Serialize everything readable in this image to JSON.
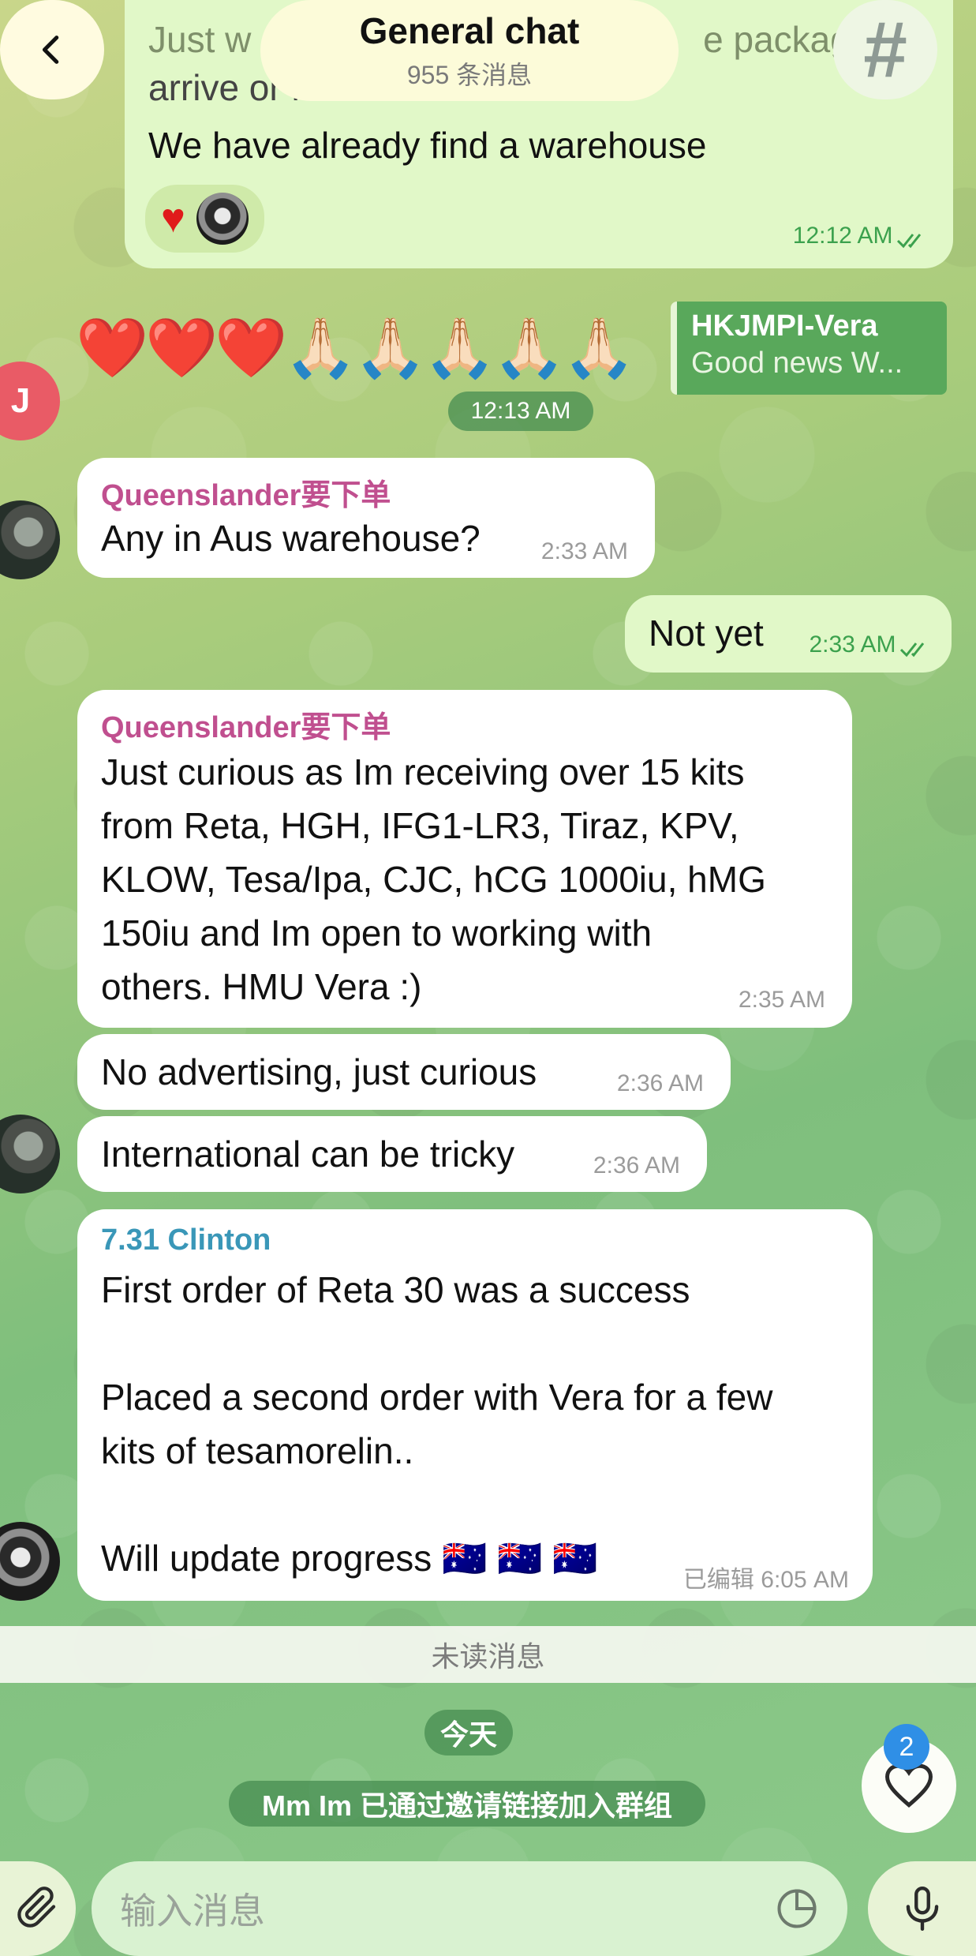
{
  "header": {
    "title": "General chat",
    "subtitle": "955 条消息"
  },
  "messages": {
    "top_partial_line1": "Just w",
    "top_partial_line1b": "e packag",
    "top_partial_line2": "arrive or not",
    "top_main": "We have already find a warehouse",
    "top_time": "12:12 AM",
    "reply_name": "HKJMPI-Vera",
    "reply_text": "Good news W...",
    "emoji_text": "❤️❤️❤️🙏🏻🙏🏻🙏🏻🙏🏻🙏🏻",
    "emoji_time": "12:13 AM",
    "j_avatar_letter": "J",
    "q1_sender": "Queenslander要下单",
    "q1_text": "Any in Aus warehouse?",
    "q1_time": "2:33 AM",
    "notyet_text": "Not yet",
    "notyet_time": "2:33 AM",
    "q2_sender": "Queenslander要下单",
    "q2_text": "Just curious as Im receiving over 15 kits\nfrom Reta, HGH, IFG1-LR3, Tiraz, KPV,\nKLOW, Tesa/Ipa, CJC, hCG 1000iu, hMG\n150iu and Im open to working with\nothers. HMU Vera :)",
    "q2_time": "2:35 AM",
    "q3_text": "No advertising, just curious",
    "q3_time": "2:36 AM",
    "q4_text": "International can be tricky",
    "q4_time": "2:36 AM",
    "c_sender": "7.31 Clinton",
    "c_text": "First order of Reta 30 was a success\n\nPlaced a second order with Vera for a few\nkits of tesamorelin..\n\nWill update progress 🇦🇺 🇦🇺 🇦🇺",
    "c_edited": "已编辑",
    "c_time": "6:05 AM"
  },
  "unread_label": "未读消息",
  "date_pill": "今天",
  "join_notice": "Mm Im 已通过邀请链接加入群组",
  "reaction_badge": "2",
  "input": {
    "placeholder": "输入消息"
  },
  "colors": {
    "outgoing_bubble": "#e1f8c8",
    "incoming_bubble": "#ffffff",
    "sender_q": "#c04f8f",
    "sender_c": "#3a97b8",
    "accent_blue": "#2f8fe6"
  }
}
